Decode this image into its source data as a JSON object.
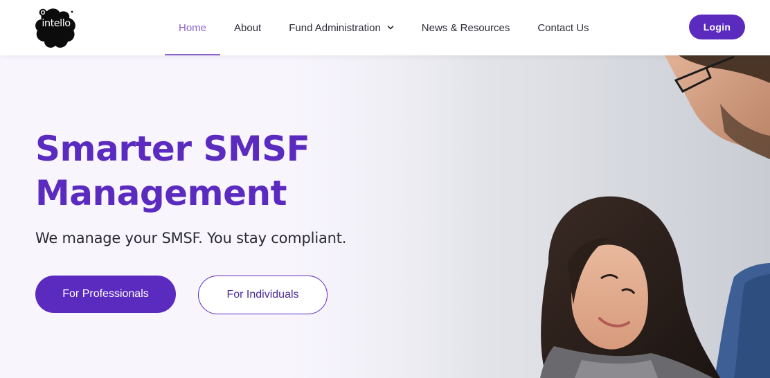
{
  "header": {
    "logo_text": "intello",
    "nav": [
      {
        "label": "Home",
        "active": true
      },
      {
        "label": "About",
        "active": false
      },
      {
        "label": "Fund Administration",
        "active": false,
        "icon": "chevron-down-icon"
      },
      {
        "label": "News & Resources",
        "active": false
      },
      {
        "label": "Contact Us",
        "active": false
      }
    ],
    "login_label": "Login"
  },
  "hero": {
    "title_line1": "Smarter SMSF",
    "title_line2": "Management",
    "subtitle": "We manage your SMSF. You stay compliant.",
    "primary_button": "For Professionals",
    "secondary_button": "For Individuals",
    "photo": "photo of a man and a woman looking at a laptop"
  },
  "colors": {
    "brand_purple": "#5b2bc0",
    "nav_active": "#8a63cf",
    "text_dark": "#2a2a33"
  }
}
